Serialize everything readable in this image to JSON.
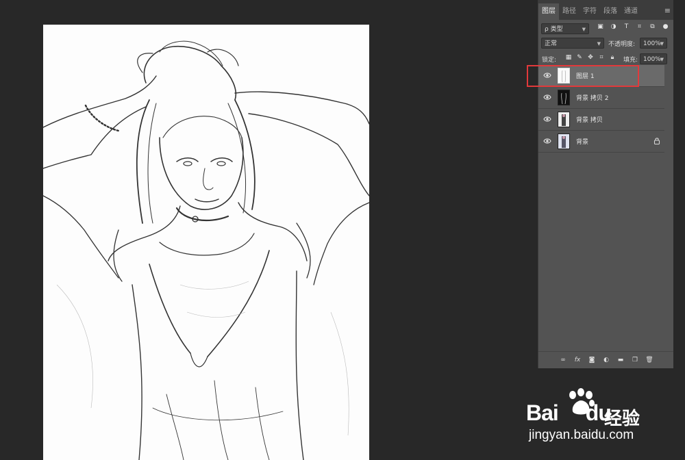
{
  "tabs": [
    {
      "label": "图层",
      "active": true
    },
    {
      "label": "路径",
      "active": false
    },
    {
      "label": "字符",
      "active": false
    },
    {
      "label": "段落",
      "active": false
    },
    {
      "label": "通道",
      "active": false
    }
  ],
  "filter": {
    "kind_label": "ρ 类型"
  },
  "blend": {
    "mode": "正常",
    "opacity_label": "不透明度:",
    "opacity_value": "100%"
  },
  "lock": {
    "label": "锁定:",
    "fill_label": "填充:",
    "fill_value": "100%"
  },
  "layers": [
    {
      "name": "图层 1",
      "selected": true,
      "locked": false
    },
    {
      "name": "背景 拷贝 2",
      "selected": false,
      "locked": false
    },
    {
      "name": "背景 拷贝",
      "selected": false,
      "locked": false
    },
    {
      "name": "背景",
      "selected": false,
      "locked": true
    }
  ],
  "watermark": {
    "brand_left": "Bai",
    "brand_right": "du",
    "product": "经验",
    "url": "jingyan.baidu.com"
  },
  "colors": {
    "highlight": "#e2393b",
    "panel": "#535353",
    "selected_layer": "#6a6a6a"
  }
}
